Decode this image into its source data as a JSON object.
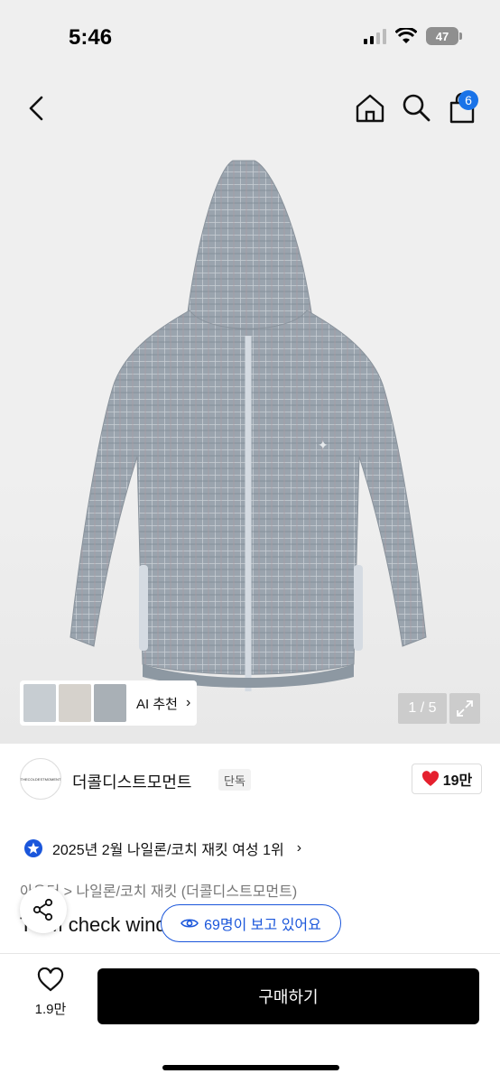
{
  "status": {
    "time": "5:46",
    "battery": "47"
  },
  "nav": {
    "cart_count": "6"
  },
  "gallery": {
    "ai_label": "AI 추천",
    "counter": "1 / 5"
  },
  "brand": {
    "name": "더콜디스트모먼트",
    "tag": "단독",
    "logo_text": "THECOLDESTMOMENT",
    "likes": "19만"
  },
  "rank": {
    "text": "2025년 2월 나일론/코치 재킷 여성 1위"
  },
  "breadcrumb": {
    "text": "아우터 > 나일론/코치 재킷 (더콜디스트모먼트)"
  },
  "product": {
    "title": "TCM check windbreaker (blue)"
  },
  "viewers": {
    "text": "69명이 보고 있어요"
  },
  "bottom": {
    "wish_count": "1.9만",
    "buy_label": "구매하기"
  },
  "colors": {
    "accent": "#1a56db",
    "badge": "#1a73e8",
    "like": "#e5202e",
    "jacket": "#9aa4ae"
  },
  "icons": [
    "back-icon",
    "home-icon",
    "search-icon",
    "cart-icon",
    "expand-icon",
    "heart-icon",
    "star-badge-icon",
    "share-icon",
    "eye-icon"
  ]
}
